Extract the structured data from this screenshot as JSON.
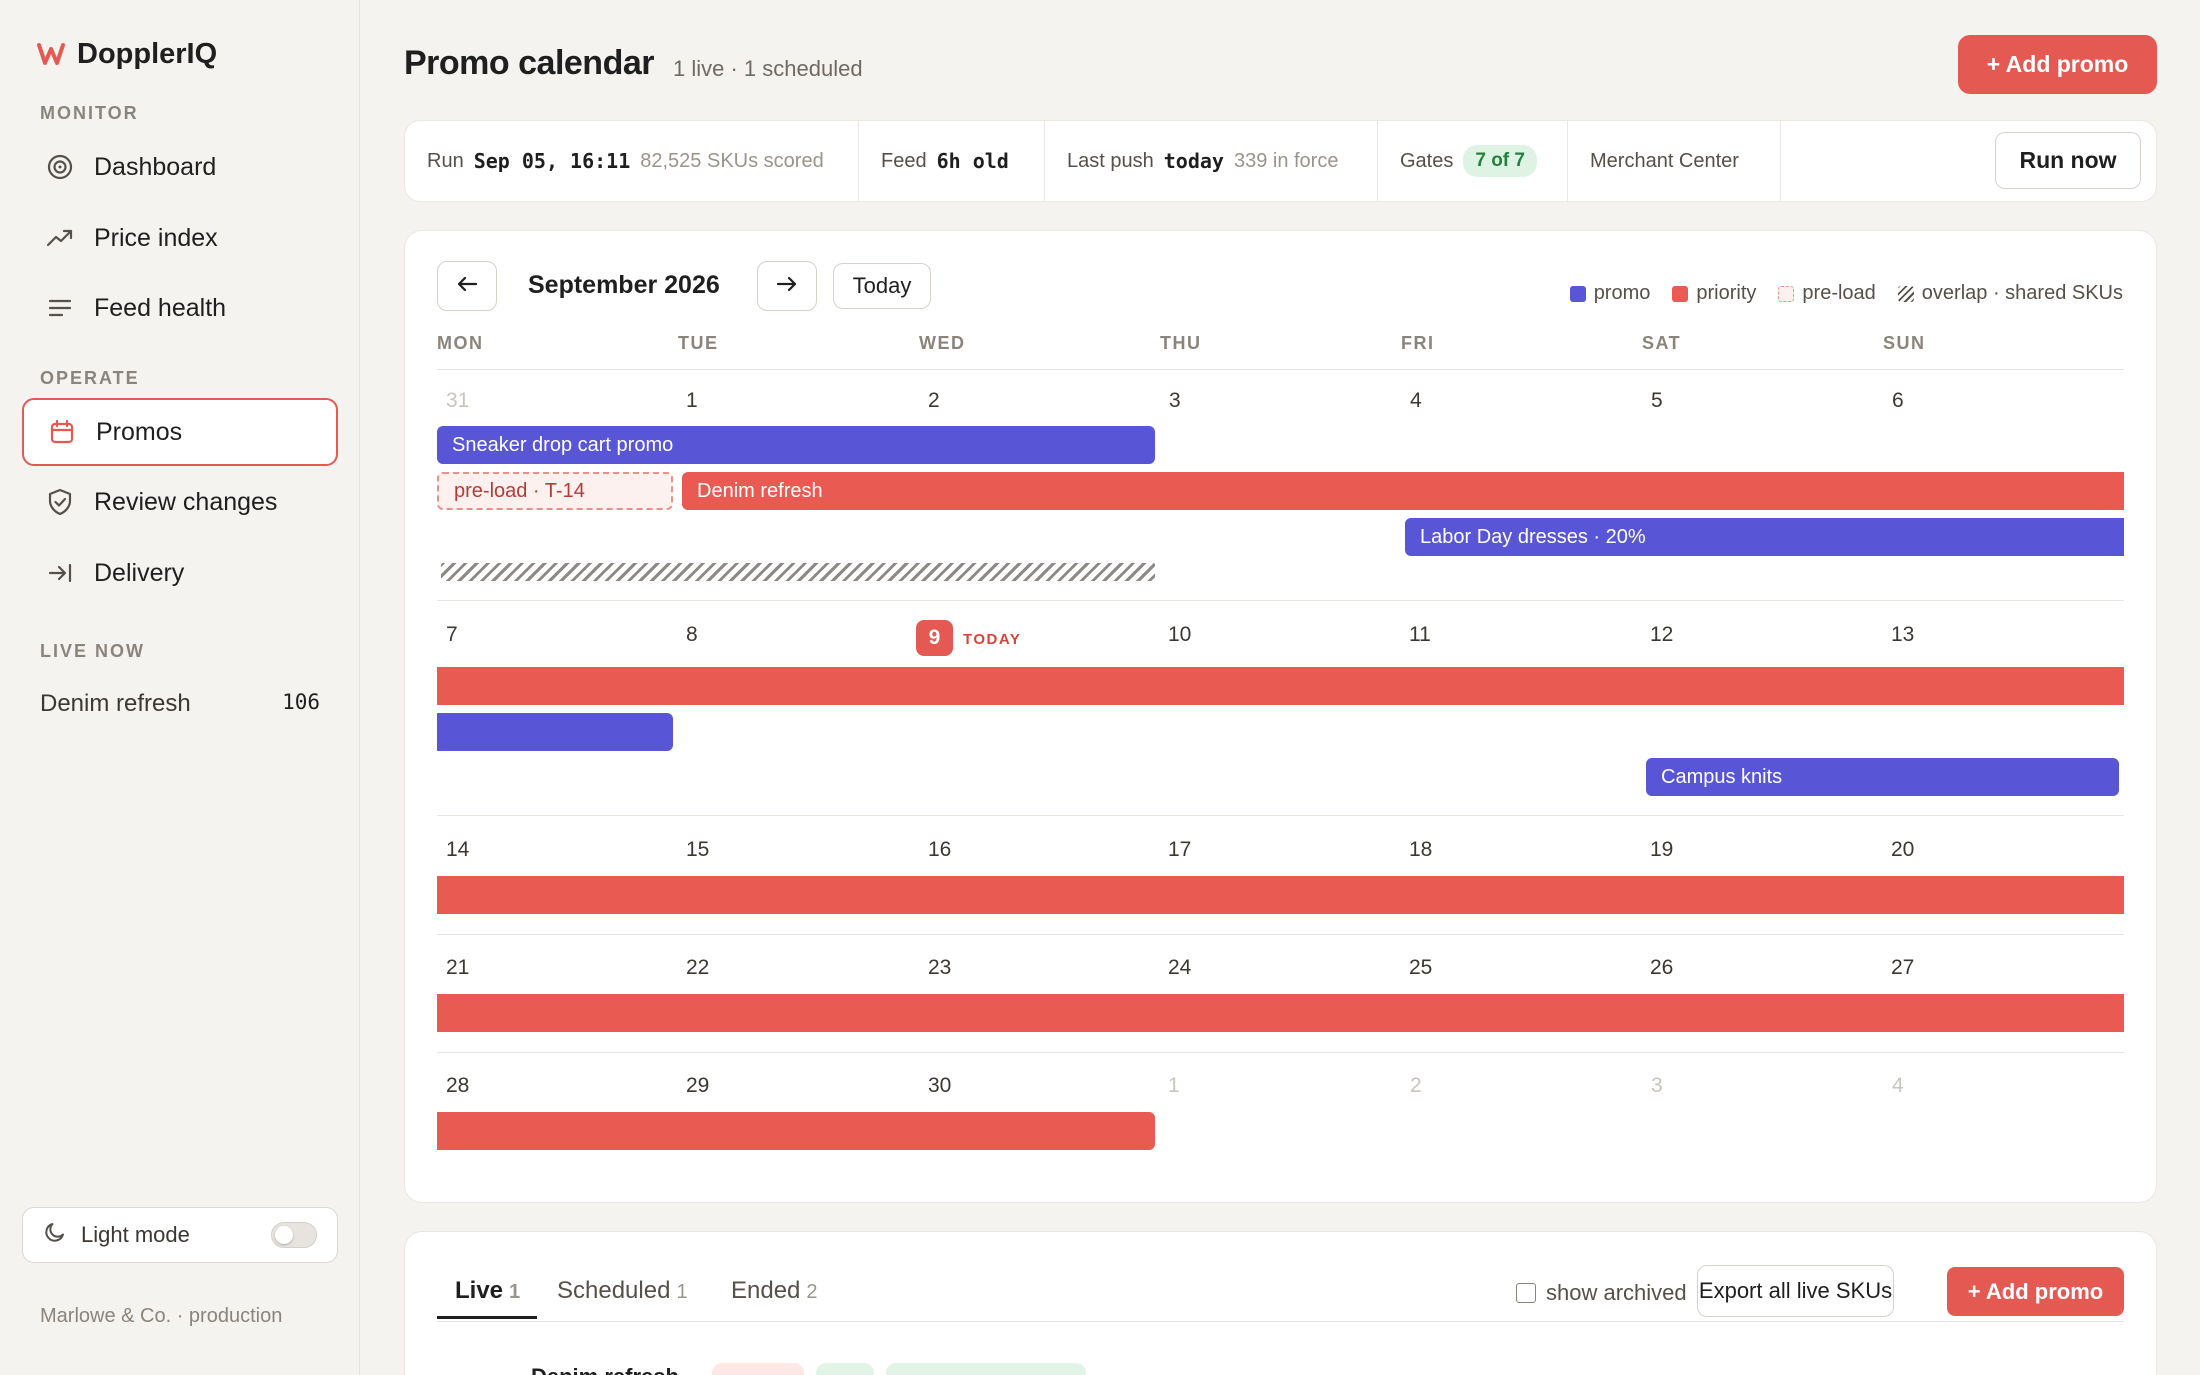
{
  "brand": {
    "name": "DopplerIQ",
    "accent": "#e45a53"
  },
  "sidebar": {
    "sections": [
      "MONITOR",
      "OPERATE",
      "LIVE NOW"
    ],
    "items": [
      {
        "label": "Dashboard",
        "icon": "target-icon"
      },
      {
        "label": "Price index",
        "icon": "trend-up-icon"
      },
      {
        "label": "Feed health",
        "icon": "lines-icon"
      },
      {
        "label": "Promos",
        "icon": "calendar-icon",
        "active": true
      },
      {
        "label": "Review changes",
        "icon": "shield-check-icon"
      },
      {
        "label": "Delivery",
        "icon": "arrow-to-line-icon"
      }
    ],
    "live_now": {
      "name": "Denim refresh",
      "count": "106"
    },
    "light_mode_label": "Light mode",
    "org": "Marlowe & Co. · production"
  },
  "header": {
    "title": "Promo calendar",
    "subtitle": "1 live · 1 scheduled",
    "add_button": "+ Add promo"
  },
  "status": {
    "run_label": "Run",
    "run_time": "Sep 05, 16:11",
    "run_skus": "82,525 SKUs scored",
    "feed_label": "Feed",
    "feed_age": "6h old",
    "push_label": "Last push",
    "push_when": "today",
    "push_count": "339 in force",
    "gates_label": "Gates",
    "gates_value": "7 of 7",
    "merchant": "Merchant Center",
    "run_now": "Run now"
  },
  "calendar": {
    "month": "September 2026",
    "today_label": "Today",
    "today_tag": "TODAY",
    "legend": [
      "promo",
      "priority",
      "pre-load",
      "overlap · shared SKUs"
    ],
    "colors": {
      "promo": "#5856d6",
      "priority": "#e85a52",
      "preload": "#e8908a"
    },
    "weekdays": [
      "MON",
      "TUE",
      "WED",
      "THU",
      "FRI",
      "SAT",
      "SUN"
    ],
    "weeks": [
      [
        "31",
        "1",
        "2",
        "3",
        "4",
        "5",
        "6"
      ],
      [
        "7",
        "8",
        "9",
        "10",
        "11",
        "12",
        "13"
      ],
      [
        "14",
        "15",
        "16",
        "17",
        "18",
        "19",
        "20"
      ],
      [
        "21",
        "22",
        "23",
        "24",
        "25",
        "26",
        "27"
      ],
      [
        "28",
        "29",
        "30",
        "1",
        "2",
        "3",
        "4"
      ]
    ],
    "events": {
      "sneaker": "Sneaker drop cart promo",
      "preload": "pre-load · T-14",
      "denim": "Denim refresh",
      "labor_day": "Labor Day dresses · 20%",
      "campus": "Campus knits"
    }
  },
  "list": {
    "tabs": [
      {
        "label": "Live",
        "count": "1"
      },
      {
        "label": "Scheduled",
        "count": "1"
      },
      {
        "label": "Ended",
        "count": "2"
      }
    ],
    "show_archived": "show archived",
    "export": "Export all live SKUs",
    "add": "+ Add promo",
    "first_row": "Denim refresh"
  }
}
